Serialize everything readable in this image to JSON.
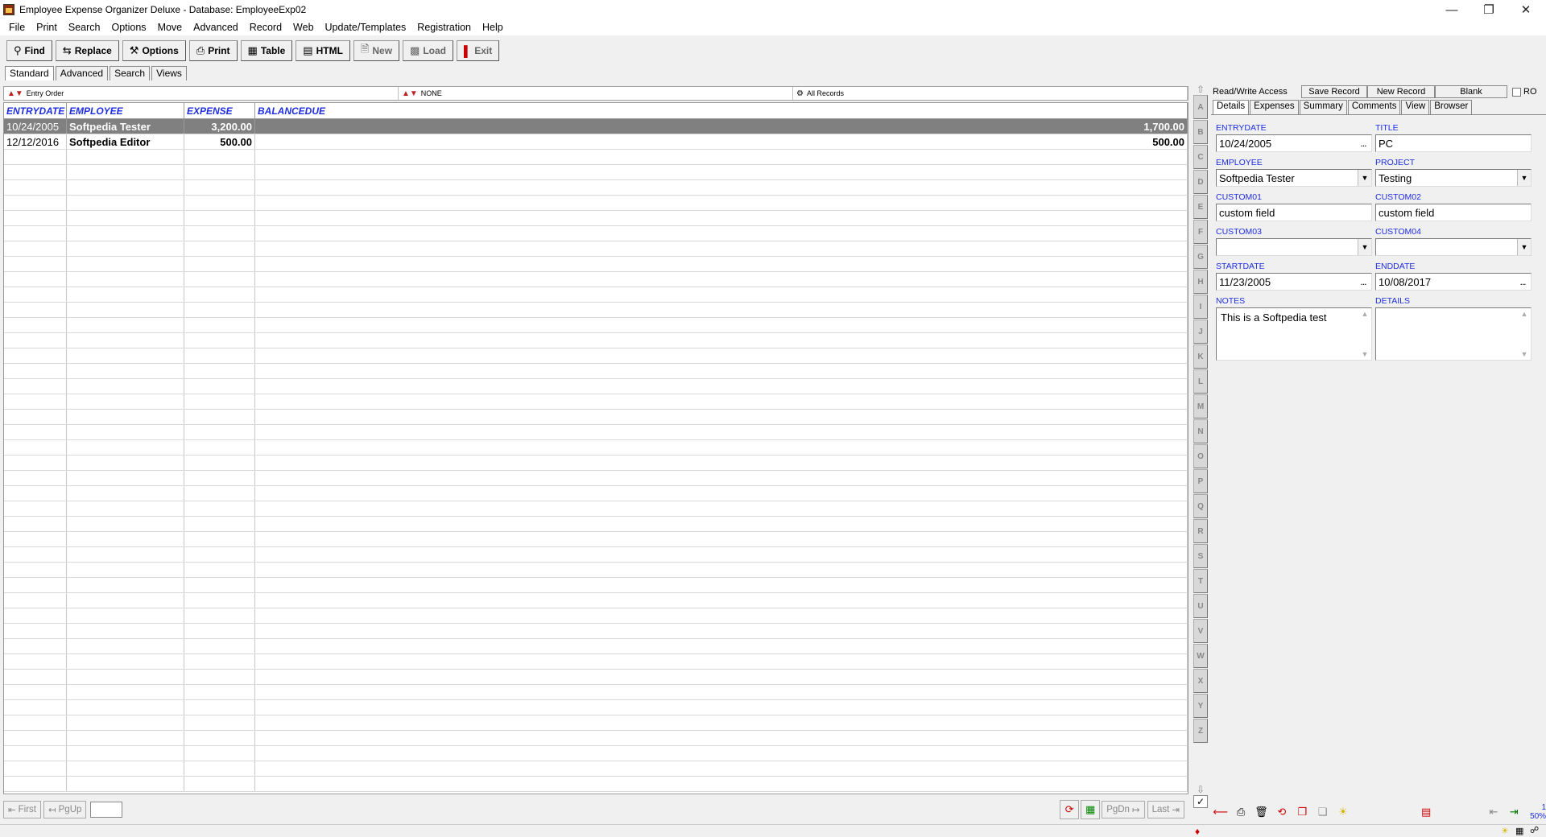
{
  "window": {
    "title": "Employee Expense Organizer Deluxe - Database: EmployeeExp02"
  },
  "menu": [
    "File",
    "Print",
    "Search",
    "Options",
    "Move",
    "Advanced",
    "Record",
    "Web",
    "Update/Templates",
    "Registration",
    "Help"
  ],
  "toolbar": {
    "find": "Find",
    "replace": "Replace",
    "options": "Options",
    "print": "Print",
    "table": "Table",
    "html": "HTML",
    "new": "New",
    "load": "Load",
    "exit": "Exit"
  },
  "mode_tabs": [
    "Standard",
    "Advanced",
    "Search",
    "Views"
  ],
  "filter": {
    "sort": "Entry Order",
    "group": "NONE",
    "records": "All Records"
  },
  "grid": {
    "columns": [
      "ENTRYDATE",
      "EMPLOYEE",
      "EXPENSE",
      "BALANCEDUE"
    ],
    "rows": [
      [
        "10/24/2005",
        "Softpedia Tester",
        "3,200.00",
        "1,700.00"
      ],
      [
        "12/12/2016",
        "Softpedia Editor",
        "500.00",
        "500.00"
      ]
    ]
  },
  "alphabet": [
    "A",
    "B",
    "C",
    "D",
    "E",
    "F",
    "G",
    "H",
    "I",
    "J",
    "K",
    "L",
    "M",
    "N",
    "O",
    "P",
    "Q",
    "R",
    "S",
    "T",
    "U",
    "V",
    "W",
    "X",
    "Y",
    "Z"
  ],
  "record_bar": {
    "access": "Read/Write Access",
    "save": "Save Record",
    "new": "New Record",
    "blank": "Blank",
    "ro": "RO"
  },
  "detail_tabs": [
    "Details",
    "Expenses",
    "Summary",
    "Comments",
    "View",
    "Browser"
  ],
  "detail": {
    "entrydate_label": "ENTRYDATE",
    "entrydate": "10/24/2005",
    "title_label": "TITLE",
    "title": "PC",
    "employee_label": "EMPLOYEE",
    "employee": "Softpedia Tester",
    "project_label": "PROJECT",
    "project": "Testing",
    "custom01_label": "CUSTOM01",
    "custom01": "custom field",
    "custom02_label": "CUSTOM02",
    "custom02": "custom field",
    "custom03_label": "CUSTOM03",
    "custom03": "",
    "custom04_label": "CUSTOM04",
    "custom04": "",
    "startdate_label": "STARTDATE",
    "startdate": "11/23/2005",
    "enddate_label": "ENDDATE",
    "enddate": "10/08/2017",
    "notes_label": "NOTES",
    "notes": "This is a Softpedia test",
    "details_label": "DETAILS",
    "details": ""
  },
  "nav": {
    "first": "First",
    "pgup": "PgUp",
    "pgdn": "PgDn",
    "last": "Last"
  },
  "zoom": {
    "count": "1",
    "percent": "50%"
  }
}
